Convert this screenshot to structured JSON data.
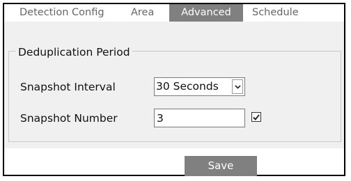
{
  "tabs": [
    {
      "label": "Detection Config",
      "active": false
    },
    {
      "label": "Area",
      "active": false
    },
    {
      "label": "Advanced",
      "active": true
    },
    {
      "label": "Schedule",
      "active": false
    }
  ],
  "group": {
    "title": "Deduplication Period"
  },
  "snapshot_interval": {
    "label": "Snapshot Interval",
    "selected": "30 Seconds",
    "arrow_icon": "chevron-down-icon"
  },
  "snapshot_number": {
    "label": "Snapshot Number",
    "value": "3",
    "checked": true
  },
  "actions": {
    "save_label": "Save"
  },
  "colors": {
    "active_tab_bg": "#808080",
    "content_bg": "#f0f0f0",
    "button_bg": "#808080",
    "tab_text": "#666666"
  }
}
